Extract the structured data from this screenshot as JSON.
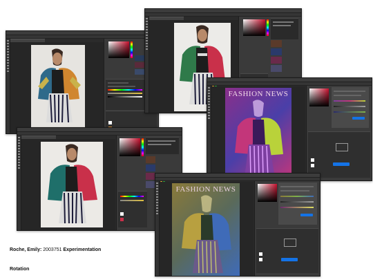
{
  "caption": {
    "name_bold": "Roche, Emily:",
    "student_id": " 2003751 ",
    "project_bold": "Experimentation",
    "subtitle": "Rotation"
  },
  "windows": [
    {
      "id": "w1",
      "poster_headline": ""
    },
    {
      "id": "w2",
      "poster_headline": ""
    },
    {
      "id": "w3",
      "poster_headline": "FASHION NEWS"
    },
    {
      "id": "w4",
      "poster_headline": ""
    },
    {
      "id": "w5",
      "poster_headline": "FASHION NEWS"
    }
  ],
  "colors": {
    "app_bg": "#2b2b2b",
    "panel_bg": "#3a3a3a",
    "accent_blue": "#1473e6",
    "jacket_original": [
      "#2f6a8a",
      "#c9b24b",
      "#d0862f"
    ],
    "jacket_green_red": [
      "#2f7a4a",
      "#c9304a"
    ],
    "poster_tint": [
      "#7d3fa0",
      "#c3367a",
      "#b9d23a"
    ],
    "poster_tint_2": [
      "#8a7a3a",
      "#3f6bb8",
      "#7fb24a"
    ]
  }
}
